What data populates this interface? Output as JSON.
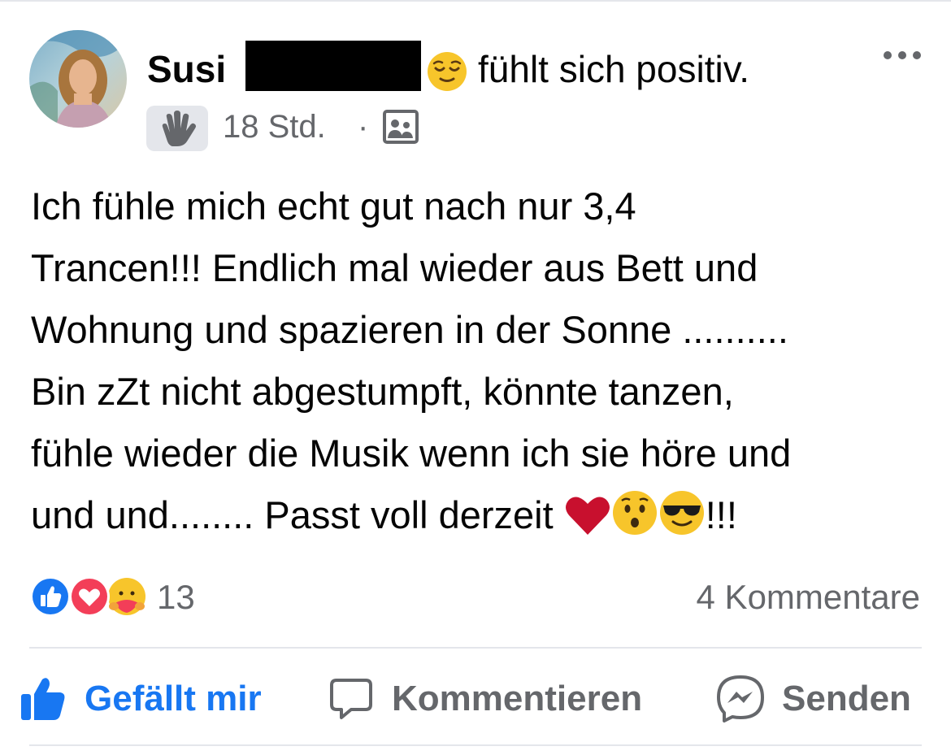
{
  "post": {
    "author_name": "Susi",
    "feeling_text": "fühlt sich positiv.",
    "time_ago": "18 Std.",
    "separator": "·",
    "icons": {
      "more": "more-options-icon",
      "wave": "wave-hand-icon",
      "audience": "audience-icon",
      "feeling": "relieved-face-emoji"
    },
    "body_lines": [
      "Ich fühle mich echt gut nach nur 3,4",
      "Trancen!!! Endlich mal wieder aus Bett und",
      "Wohnung und spazieren in der Sonne ..........",
      "Bin zZt nicht abgestumpft, könnte tanzen,",
      "fühle wieder die Musik wenn ich sie höre und",
      "und und........ Passt voll derzeit",
      "!!!"
    ],
    "body_emojis": [
      "red-heart",
      "hushed-face",
      "sunglasses-face"
    ]
  },
  "stats": {
    "reaction_count": "13",
    "reaction_types": [
      "like",
      "love",
      "care"
    ],
    "comments_label": "4 Kommentare"
  },
  "actions": {
    "like": "Gefällt mir",
    "comment": "Kommentieren",
    "share": "Senden"
  },
  "colors": {
    "accent": "#1877f2",
    "secondary_text": "#65676b",
    "divider": "#e4e6eb",
    "love": "#f33e58",
    "emoji_yellow": "#f7c52b"
  }
}
